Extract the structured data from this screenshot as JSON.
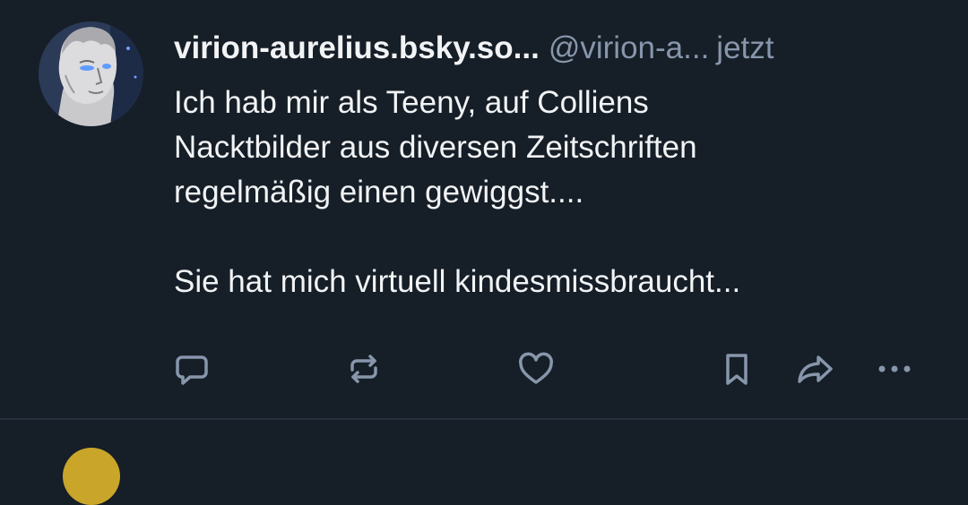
{
  "post": {
    "author": {
      "display_name": "virion-aurelius.bsky.so...",
      "handle": "@virion-a...",
      "avatar_icon": "statue-head-avatar"
    },
    "timestamp": "jetzt",
    "text_lines": [
      "Ich hab mir als Teeny, auf Colliens",
      "Nacktbilder aus diversen Zeitschriften",
      "regelmäßig einen gewiggst....",
      "Sie hat mich virtuell kindesmissbraucht..."
    ],
    "actions": {
      "reply_icon": "reply-icon",
      "repost_icon": "repost-icon",
      "like_icon": "heart-icon",
      "bookmark_icon": "bookmark-icon",
      "share_icon": "share-icon",
      "more_icon": "more-options-icon"
    }
  },
  "colors": {
    "background": "#161e27",
    "text_primary": "#f1f3f5",
    "text_secondary": "#8796ab",
    "icon": "#8796ab",
    "divider": "#26303c"
  }
}
